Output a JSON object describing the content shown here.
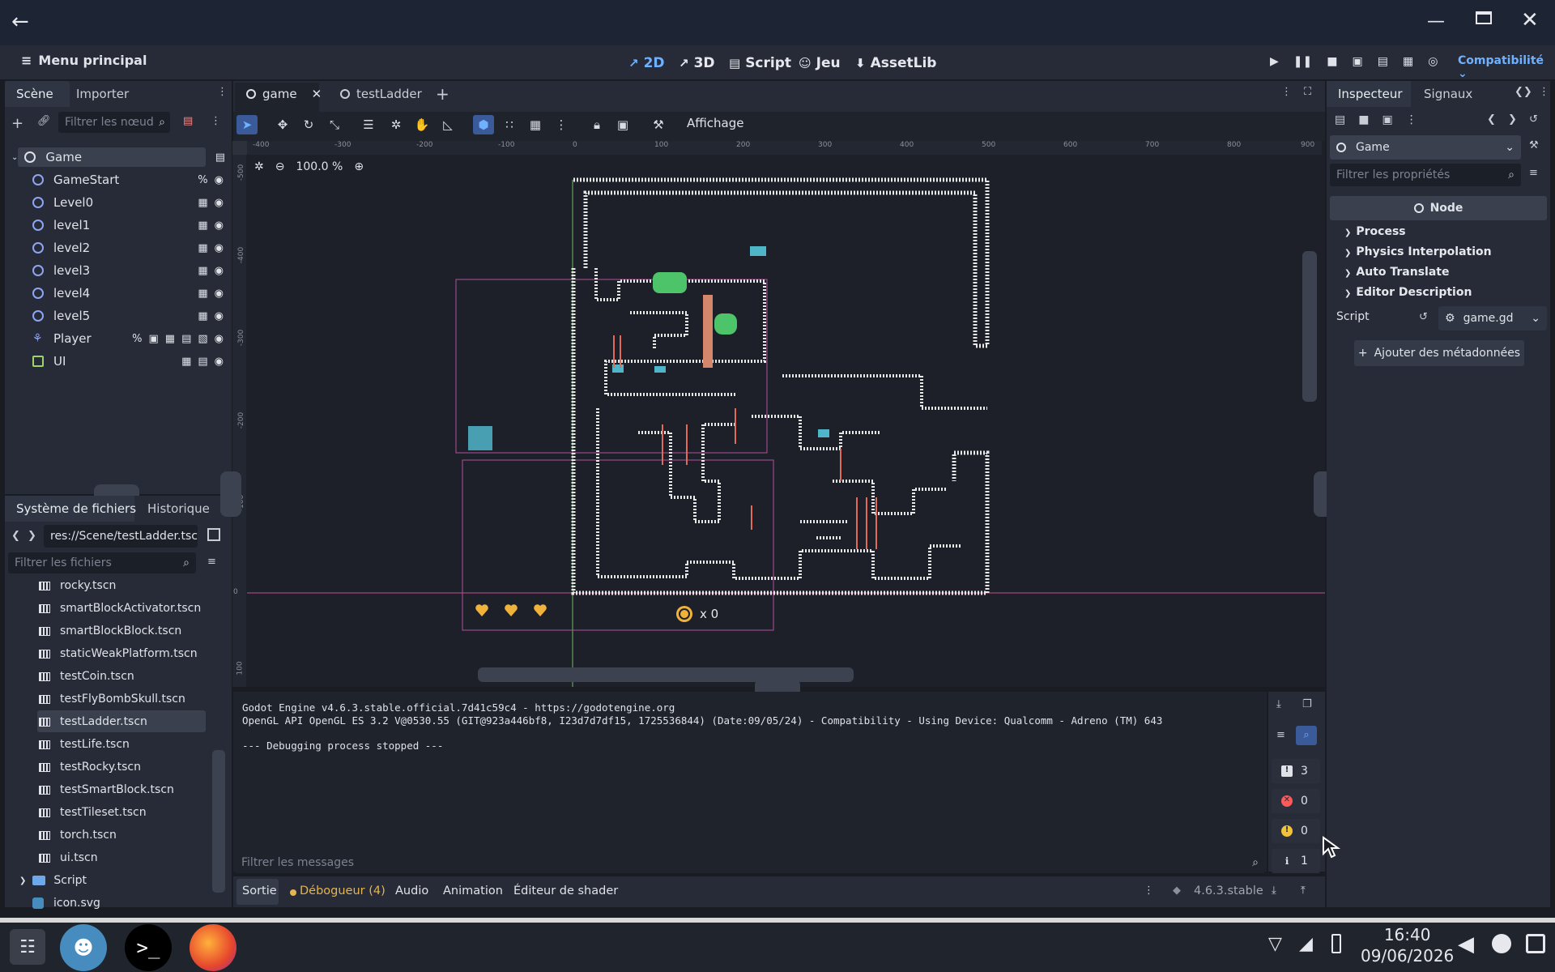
{
  "workspaces": [
    {
      "label": "2D",
      "icon": "2d-icon",
      "active": true
    },
    {
      "label": "3D",
      "icon": "3d-icon",
      "active": false
    },
    {
      "label": "Script",
      "icon": "script-icon",
      "active": false
    },
    {
      "label": "Jeu",
      "icon": "game-icon",
      "active": false
    },
    {
      "label": "AssetLib",
      "icon": "assetlib-icon",
      "active": false
    }
  ],
  "main_menu_label": "Menu principal",
  "renderer_label": "Compatibilité",
  "scene_dock": {
    "tabs": [
      "Scène",
      "Importer"
    ],
    "filter_placeholder": "Filtrer les nœud",
    "nodes": [
      {
        "name": "Game",
        "root": true
      },
      {
        "name": "GameStart"
      },
      {
        "name": "Level0"
      },
      {
        "name": "level1"
      },
      {
        "name": "level2"
      },
      {
        "name": "level3"
      },
      {
        "name": "level4"
      },
      {
        "name": "level5"
      },
      {
        "name": "Player"
      },
      {
        "name": "UI"
      }
    ]
  },
  "filesystem_dock": {
    "tabs": [
      "Système de fichiers",
      "Historique"
    ],
    "path": "res://Scene/testLadder.tsc",
    "filter_placeholder": "Filtrer les fichiers",
    "files": [
      "rocky.tscn",
      "smartBlockActivator.tscn",
      "smartBlockBlock.tscn",
      "staticWeakPlatform.tscn",
      "testCoin.tscn",
      "testFlyBombSkull.tscn",
      "testLadder.tscn",
      "testLife.tscn",
      "testRocky.tscn",
      "testSmartBlock.tscn",
      "testTileset.tscn",
      "torch.tscn",
      "ui.tscn"
    ],
    "selected_file": "testLadder.tscn",
    "folder": "Script",
    "last_file": "icon.svg"
  },
  "editor_tabs": [
    {
      "label": "game",
      "active": true
    },
    {
      "label": "testLadder",
      "active": false
    }
  ],
  "toolbar": {
    "view_label": "Affichage",
    "zoom": "100.0 %"
  },
  "rulers": {
    "h_ticks": [
      "-400",
      "-300",
      "-200",
      "-100",
      "0",
      "100",
      "200",
      "300",
      "400",
      "500",
      "600",
      "700",
      "800",
      "900"
    ],
    "v_ticks": [
      "-500",
      "-400",
      "-300",
      "-200",
      "-100",
      "0",
      "100"
    ]
  },
  "hud": {
    "coins": "x 0"
  },
  "inspector": {
    "tabs": [
      "Inspecteur",
      "Signaux"
    ],
    "node_select": "Game",
    "filter_placeholder": "Filtrer les propriétés",
    "node_class": "Node",
    "sections": [
      "Process",
      "Physics Interpolation",
      "Auto Translate",
      "Editor Description"
    ],
    "script_label": "Script",
    "script_value": "game.gd",
    "add_metadata": "Ajouter des métadonnées"
  },
  "output": {
    "lines": [
      "Godot Engine v4.6.3.stable.official.7d41c59c4 - https://godotengine.org",
      "OpenGL API OpenGL ES 3.2 V@0530.55 (GIT@923a446bf8, I23d7d7df15, 1725536844) (Date:09/05/24) - Compatibility - Using Device: Qualcomm - Adreno (TM) 643",
      "",
      "--- Debugging process stopped ---"
    ],
    "filter_placeholder": "Filtrer les messages",
    "counts": [
      "3",
      "0",
      "0",
      "1"
    ]
  },
  "bottom_tabs": [
    "Sortie",
    "Débogueur (4)",
    "Audio",
    "Animation",
    "Éditeur de shader"
  ],
  "version": "4.6.3.stable",
  "taskbar": {
    "time": "16:40",
    "date": "09/06/2026"
  }
}
